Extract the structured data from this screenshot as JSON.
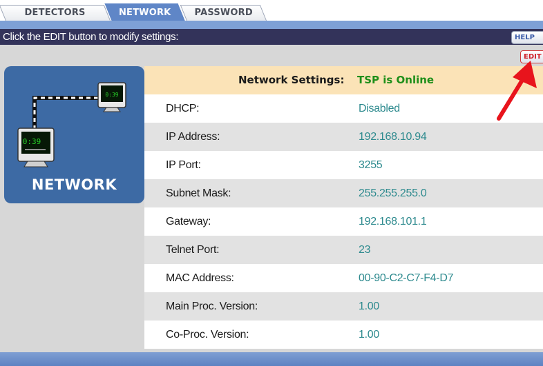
{
  "tabs": [
    {
      "label": "DETECTORS",
      "active": false
    },
    {
      "label": "NETWORK",
      "active": true
    },
    {
      "label": "PASSWORD",
      "active": false
    }
  ],
  "header": {
    "instruction": "Click the EDIT button to modify settings:",
    "help_label": "HELP",
    "edit_label": "EDIT"
  },
  "badge": {
    "label": "NETWORK",
    "screen_large": "0:39",
    "screen_small": "0:39",
    "icon": "network-monitors-icon"
  },
  "network": {
    "title": "Network Settings:",
    "status": "TSP is Online",
    "rows": [
      {
        "label": "DHCP:",
        "value": "Disabled"
      },
      {
        "label": "IP Address:",
        "value": "192.168.10.94"
      },
      {
        "label": "IP Port:",
        "value": "3255"
      },
      {
        "label": "Subnet Mask:",
        "value": "255.255.255.0"
      },
      {
        "label": "Gateway:",
        "value": "192.168.101.1"
      },
      {
        "label": "Telnet Port:",
        "value": "23"
      },
      {
        "label": "MAC Address:",
        "value": "00-90-C2-C7-F4-D7"
      },
      {
        "label": "Main Proc. Version:",
        "value": "1.00"
      },
      {
        "label": "Co-Proc. Version:",
        "value": "1.00"
      }
    ]
  },
  "colors": {
    "header_bg": "#33335a",
    "tab_active": "#5f86c7",
    "value_text": "#2d8a8e",
    "status_online": "#1f8f1a",
    "title_bg": "#fbe3b7",
    "arrow": "#e8141c"
  }
}
